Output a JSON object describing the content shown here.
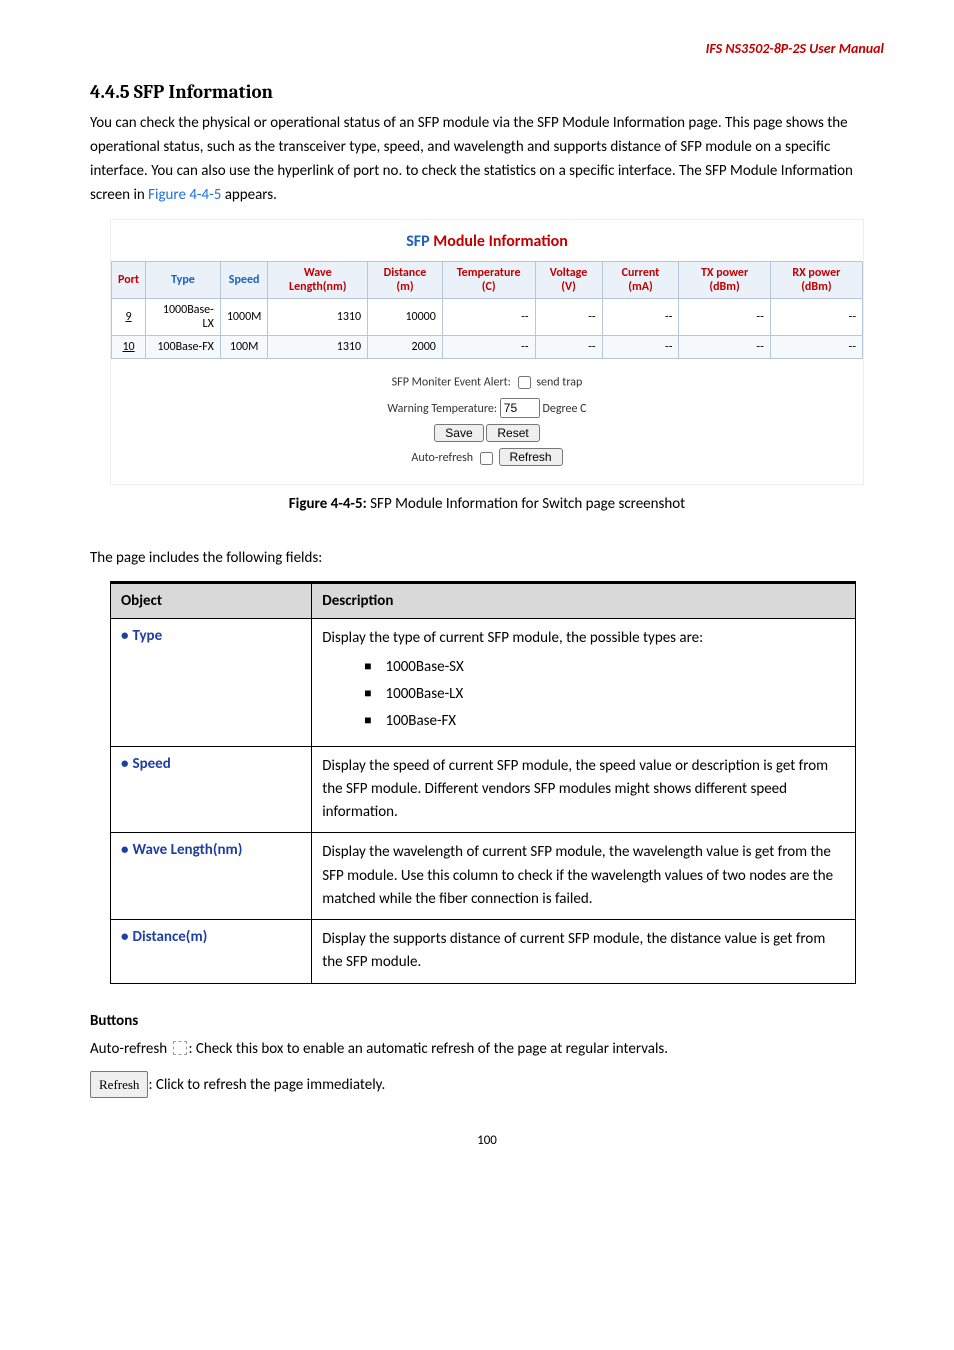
{
  "header": {
    "manual_title": "IFS  NS3502-8P-2S  User Manual"
  },
  "section": {
    "number": "4.4.5",
    "title": "SFP Information",
    "intro_pre": "You can check the physical or operational status of an SFP module via the SFP Module Information page. This page shows the operational status, such as the transceiver type, speed, and wavelength and supports distance of SFP module on a specific interface. You can also use the hyperlink of port no. to check the statistics on a specific interface. The SFP Module Information screen in ",
    "intro_ref": "Figure 4-4-5",
    "intro_post": " appears."
  },
  "panel": {
    "title_blue": "SFP",
    "title_red": " Module Information",
    "cols": {
      "port": "Port",
      "type": "Type",
      "speed": "Speed",
      "wave": "Wave Length(nm)",
      "dist": "Distance (m)",
      "temp": "Temperature (C)",
      "volt": "Voltage (V)",
      "curr": "Current (mA)",
      "txp": "TX power (dBm)",
      "rxp": "RX power (dBm)"
    },
    "rows": [
      {
        "port": "9",
        "type": "1000Base-LX",
        "speed": "1000M",
        "wave": "1310",
        "dist": "10000",
        "temp": "--",
        "volt": "--",
        "curr": "--",
        "txp": "--",
        "rxp": "--"
      },
      {
        "port": "10",
        "type": "100Base-FX",
        "speed": "100M",
        "wave": "1310",
        "dist": "2000",
        "temp": "--",
        "volt": "--",
        "curr": "--",
        "txp": "--",
        "rxp": "--"
      }
    ],
    "alert_label": "SFP Moniter Event Alert:",
    "alert_send_trap": "send trap",
    "warning_label": "Warning Temperature:",
    "warning_value": "75",
    "degree_c": "Degree C",
    "save": "Save",
    "reset": "Reset",
    "auto_refresh": "Auto-refresh",
    "refresh": "Refresh"
  },
  "fig_caption": {
    "strong": "Figure 4-4-5:",
    "rest": " SFP Module Information for Switch page screenshot"
  },
  "fields_intro": "The page includes the following fields:",
  "fields_table": {
    "head": {
      "object": "Object",
      "desc": "Description"
    },
    "rows": [
      {
        "obj": "Type",
        "desc_main": "Display the type of current SFP module, the possible types are:",
        "list": [
          "1000Base-SX",
          "1000Base-LX",
          "100Base-FX"
        ]
      },
      {
        "obj": "Speed",
        "desc_main": "Display the speed of current SFP module, the speed value or description is get from the SFP module. Different vendors SFP modules might shows different speed information."
      },
      {
        "obj": "Wave Length(nm)",
        "desc_main": "Display the wavelength of current SFP module, the wavelength value is get from the SFP module. Use this column to check if the wavelength values of two nodes are the matched while the fiber connection is failed."
      },
      {
        "obj": "Distance(m)",
        "desc_main": "Display the supports distance of current SFP module, the distance value is get from the SFP module."
      }
    ]
  },
  "buttons_h": "Buttons",
  "buttons_line1_pre": "Auto-refresh  ",
  "buttons_line1_post": ": Check this box to enable an automatic refresh of the page at regular intervals.",
  "buttons_refresh_label": "Refresh",
  "buttons_line2_post": ": Click to refresh the page immediately.",
  "page_num": "100"
}
